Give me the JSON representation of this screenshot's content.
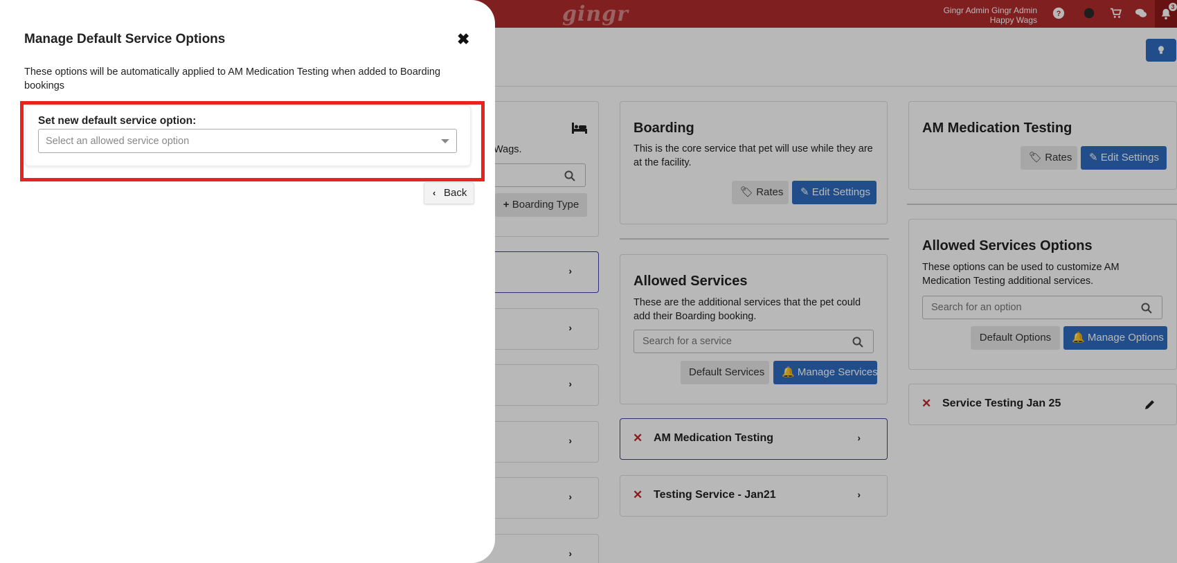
{
  "topbar": {
    "logo": "gingr",
    "user_name": "Gingr Admin Gingr Admin",
    "facility": "Happy Wags",
    "notification_count": "3"
  },
  "left_panel": {
    "partial_text": "Wags.",
    "add_button": "Boarding Type"
  },
  "boarding_panel": {
    "title": "Boarding",
    "description": "This is the core service that pet will use while they are at the facility.",
    "rates_button": "Rates",
    "edit_button": "Edit Settings"
  },
  "allowed_services_panel": {
    "title": "Allowed Services",
    "description": "These are the additional services that the pet could add their Boarding booking.",
    "search_placeholder": "Search for a service",
    "default_button": "Default Services",
    "manage_button": "Manage Services"
  },
  "services": [
    {
      "label": "AM Medication Testing",
      "selected": true
    },
    {
      "label": "Testing Service - Jan21",
      "selected": false
    }
  ],
  "am_medication_panel": {
    "title": "AM Medication Testing",
    "rates_button": "Rates",
    "edit_button": "Edit Settings"
  },
  "allowed_options_panel": {
    "title": "Allowed Services Options",
    "description": "These options can be used to customize AM Medication Testing additional services.",
    "search_placeholder": "Search for an option",
    "default_button": "Default Options",
    "manage_button": "Manage Options"
  },
  "options": [
    {
      "label": "Service Testing Jan 25"
    }
  ],
  "modal": {
    "title": "Manage Default Service Options",
    "close_glyph": "✖",
    "description": "These options will be automatically applied to AM Medication Testing when added to Boarding bookings",
    "field_label": "Set new default service option:",
    "select_placeholder": "Select an allowed service option",
    "back_button": "Back"
  },
  "colors": {
    "topbar": "#b22b2b",
    "primary_button": "#2f6cc0",
    "highlight": "#e8231d",
    "delete_x": "#c0282c"
  }
}
